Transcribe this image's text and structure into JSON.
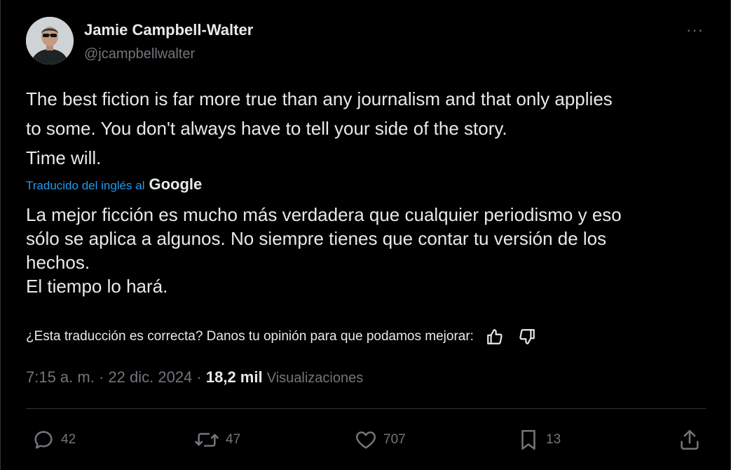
{
  "author": {
    "name": "Jamie Campbell-Walter",
    "handle": "@jcampbellwalter"
  },
  "more_label": "···",
  "original_text": [
    "The best fiction is far more true than any journalism and that only applies",
    "to some. You don't always have to tell your side of the story.",
    "Time will."
  ],
  "translation": {
    "label": "Traducido del inglés al",
    "provider": "Google",
    "text": [
      "La mejor ficción es mucho más verdadera que cualquier periodismo y eso",
      "sólo se aplica a algunos. No siempre tienes que contar tu versión de los",
      "hechos.",
      "El tiempo lo hará."
    ],
    "feedback_prompt": "¿Esta traducción es correcta? Danos tu opinión para que podamos mejorar:"
  },
  "meta": {
    "time": "7:15 a. m.",
    "separator": "·",
    "date": "22 dic. 2024",
    "views_count": "18,2 mil",
    "views_label": "Visualizaciones"
  },
  "actions": {
    "replies": "42",
    "reposts": "47",
    "likes": "707",
    "bookmarks": "13"
  },
  "colors": {
    "background": "#000000",
    "text": "#e7e9ea",
    "muted": "#71767b",
    "link": "#1d9bf0",
    "border": "#2f3336"
  },
  "icons": [
    "more-icon",
    "thumbs-up-icon",
    "thumbs-down-icon",
    "reply-icon",
    "repost-icon",
    "like-icon",
    "bookmark-icon",
    "share-icon"
  ]
}
